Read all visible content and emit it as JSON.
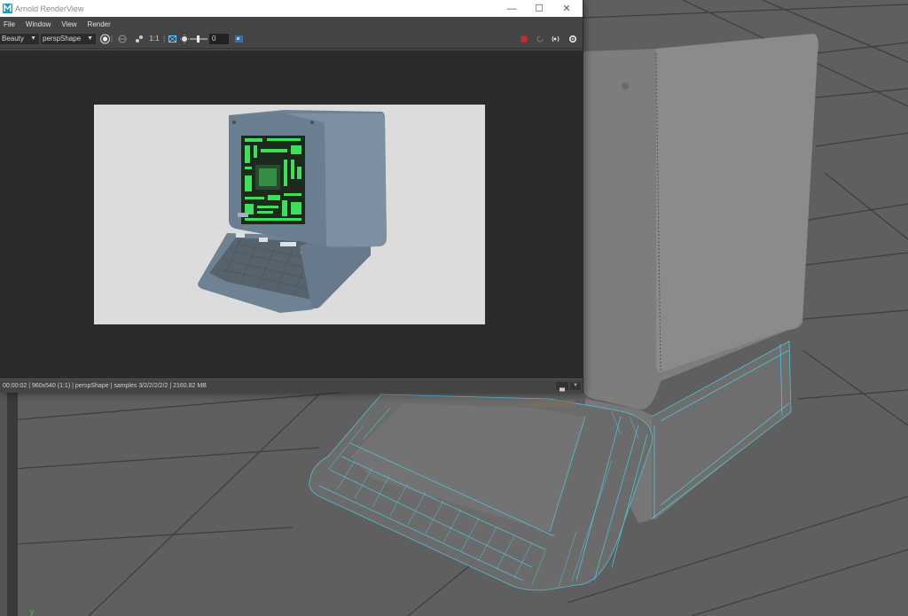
{
  "window": {
    "title": "Arnold RenderView",
    "minimize_glyph": "—",
    "maximize_glyph": "☐",
    "close_glyph": "✕"
  },
  "menu": {
    "items": [
      {
        "label": "File"
      },
      {
        "label": "Window"
      },
      {
        "label": "View"
      },
      {
        "label": "Render"
      }
    ]
  },
  "toolbar": {
    "aov_value": "Beauty",
    "camera_value": "perspShape",
    "ratio_label": "1:1",
    "exposure_value": "0"
  },
  "status": {
    "text": "00:00:02 | 960x540 (1:1) | perspShape  | samples 3/2/2/2/2/2 | 2160.82 MB"
  },
  "colors": {
    "viewport_bg": "#5d5d5d",
    "wire": "#4ecbe0",
    "stop_red": "#cc2b2b",
    "screen_green": "#3ee05a"
  },
  "icons": {
    "app": "maya-logo-icon",
    "render_region": "render-region-icon",
    "stop": "stop-render-icon",
    "refresh": "refresh-icon"
  }
}
